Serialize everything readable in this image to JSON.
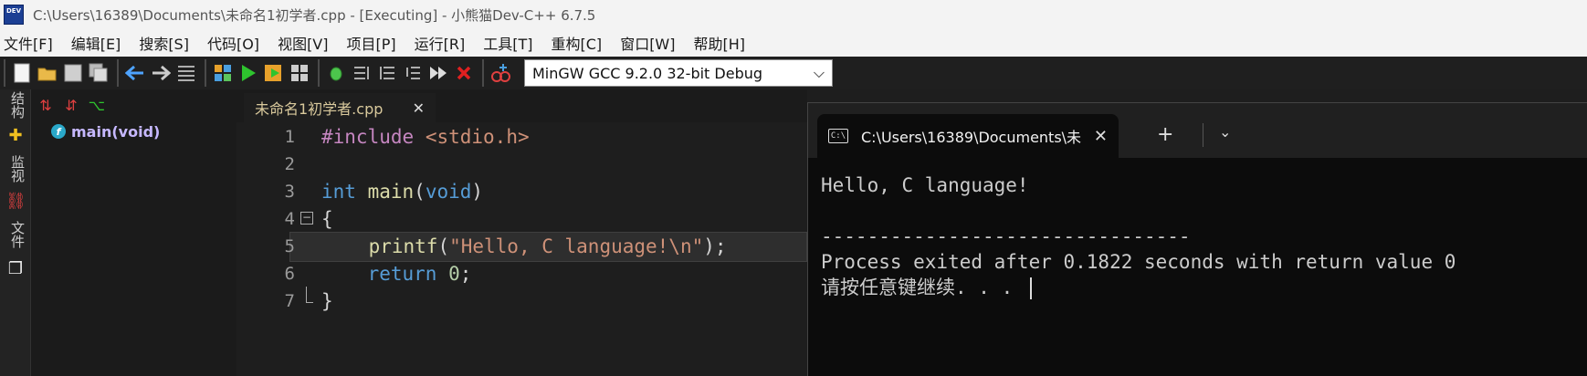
{
  "window": {
    "title": "C:\\Users\\16389\\Documents\\未命名1初学者.cpp - [Executing] - 小熊猫Dev-C++ 6.7.5",
    "app_icon_text": "DEV"
  },
  "menu": [
    "文件[F]",
    "编辑[E]",
    "搜索[S]",
    "代码[O]",
    "视图[V]",
    "项目[P]",
    "运行[R]",
    "工具[T]",
    "重构[C]",
    "窗口[W]",
    "帮助[H]"
  ],
  "toolbar": {
    "compiler": "MinGW GCC 9.2.0 32-bit Debug"
  },
  "sidebar": {
    "tabs": [
      "结构",
      "监视",
      "文件"
    ]
  },
  "class_browser": {
    "items": [
      {
        "icon": "f",
        "label": "main(void)"
      }
    ]
  },
  "editor": {
    "tab_label": "未命名1初学者.cpp",
    "tab_close": "✕",
    "line_numbers": [
      "1",
      "2",
      "3",
      "4",
      "5",
      "6",
      "7"
    ]
  },
  "console": {
    "tab_title": "C:\\Users\\16389\\Documents\\未",
    "tab_close": "✕",
    "add": "+",
    "dropdown": "⌄",
    "lines": [
      "Hello, C language!",
      "",
      "--------------------------------",
      "Process exited after 0.1822 seconds with return value 0",
      "请按任意键继续. . . "
    ]
  }
}
